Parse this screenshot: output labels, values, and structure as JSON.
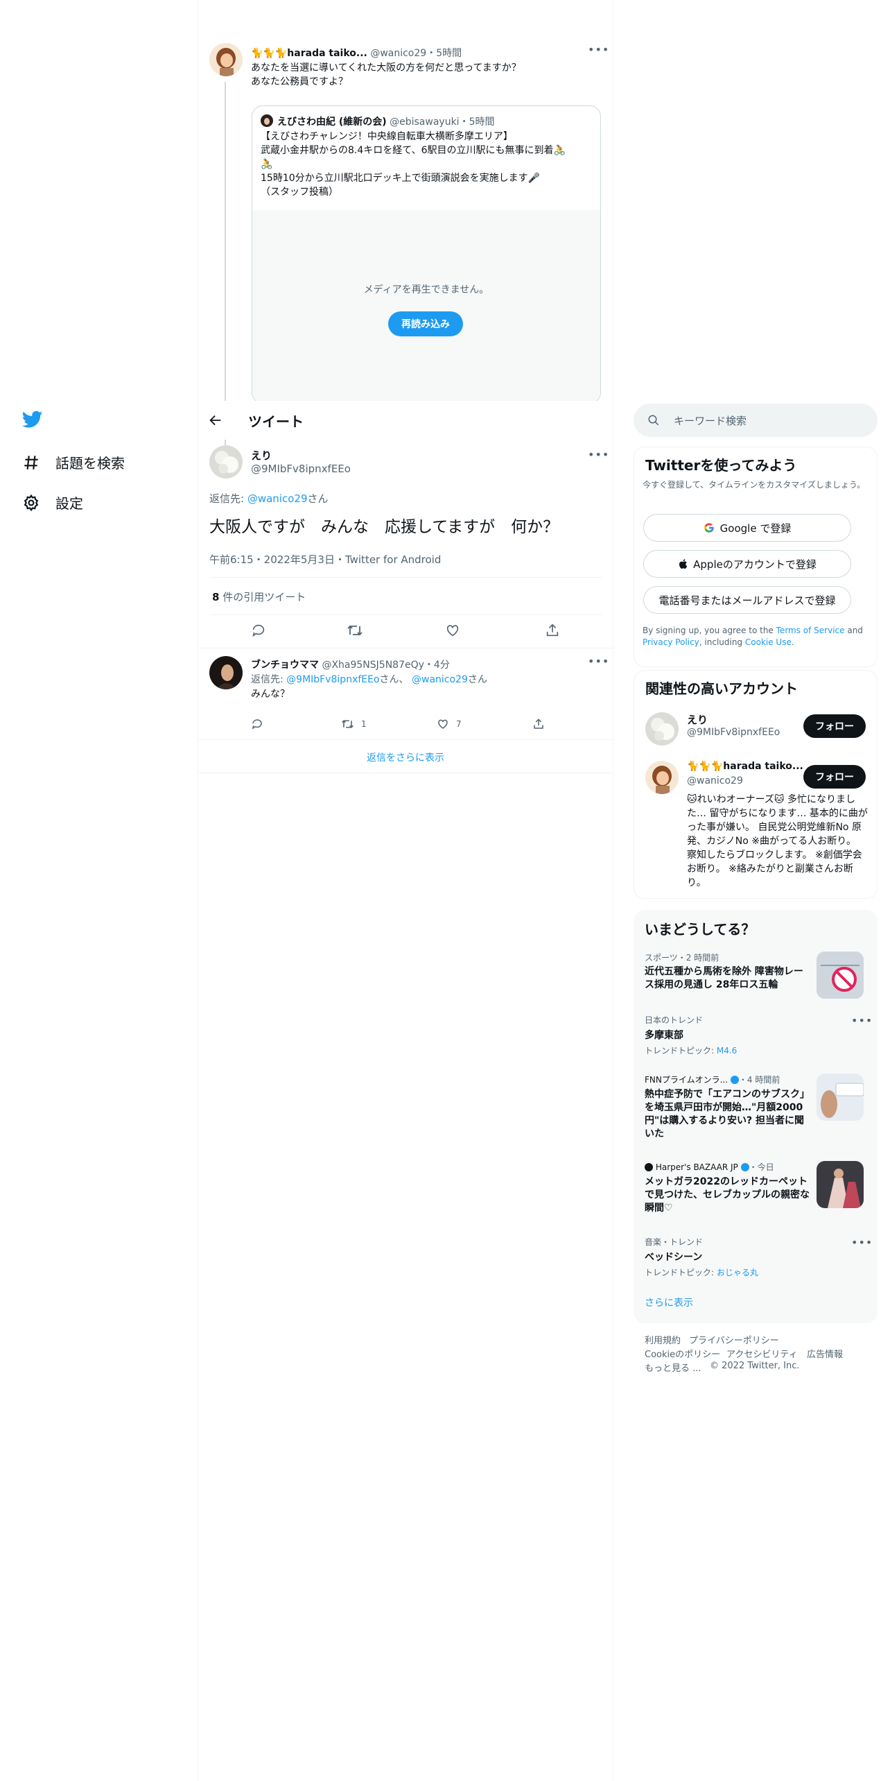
{
  "nav": {
    "items": [
      {
        "label": "話題を検索",
        "icon": "hashtag-icon"
      },
      {
        "label": "設定",
        "icon": "gear-icon"
      }
    ]
  },
  "parent_tweet": {
    "emoji": "🐈🐈🐈",
    "name": "harada taiko...",
    "handle": "@wanico29",
    "time": "5時間",
    "line1": "あなたを当選に導いてくれた大阪の方を何だと思ってますか？",
    "line2": "あなた公務員ですよ？"
  },
  "quoted_tweet": {
    "name": "えびさわ由紀 (維新の会)",
    "handle": "@ebisawayuki",
    "time": "5時間",
    "line1": "【えびさわチャレンジ！中央線自転車大横断多摩エリア】",
    "line2": "武蔵小金井駅からの8.4キロを経て、6駅目の立川駅にも無事に到着🚴",
    "line2b": "🚴",
    "line3": "15時10分から立川駅北口デッキ上で街頭演説会を実施します🎤",
    "line4": "（スタッフ投稿）",
    "media_message": "メディアを再生できません。",
    "reload_label": "再読み込み"
  },
  "header": {
    "title": "ツイート"
  },
  "main_tweet": {
    "name": "えり",
    "handle": "@9MIbFv8ipnxfEEo",
    "reply_prefix": "返信先:",
    "reply_to": "@wanico29",
    "reply_suffix": "さん",
    "text": "大阪人ですが　みんな　応援してますが　何か？",
    "timestamp": "午前6:15・2022年5月3日・Twitter for Android",
    "quote_count": "8",
    "quote_label": "件の引用ツイート"
  },
  "reply_tweet": {
    "name": "ブンチョウママ",
    "handle": "@Xha95NSJ5N87eQy",
    "time": "4分",
    "reply_prefix": "返信先:",
    "reply_to1": "@9MIbFv8ipnxfEEo",
    "reply_mid": "さん、",
    "reply_to2": "@wanico29",
    "reply_suffix": "さん",
    "text": "みんな？",
    "retweets": "1",
    "likes": "7"
  },
  "show_more_replies": "返信をさらに表示",
  "search": {
    "placeholder": "キーワード検索"
  },
  "signup": {
    "title": "Twitterを使ってみよう",
    "subtitle": "今すぐ登録して、タイムラインをカスタマイズしましょう。",
    "google_label": "Google で登録",
    "apple_label": "Appleのアカウントで登録",
    "phone_label": "電話番号またはメールアドレスで登録",
    "terms_pre": "By signing up, you agree to the ",
    "terms_link": "Terms of Service",
    "terms_and": " and ",
    "privacy_link": "Privacy Policy",
    "terms_including": ", including ",
    "cookie_link": "Cookie Use",
    "terms_end": "."
  },
  "related": {
    "title": "関連性の高いアカウント",
    "follow_label": "フォロー",
    "accounts": [
      {
        "name": "えり",
        "handle": "@9MIbFv8ipnxfEEo"
      },
      {
        "emoji": "🐈🐈🐈",
        "name": "harada taiko...",
        "handle": "@wanico29",
        "bio": "🐱れいわオーナーズ🐱 多忙になりました… 留守がちになります… 基本的に曲がった事が嫌い。 自民党公明党維新No 原発、カジノNo ※曲がってる人お断り。 察知したらブロックします。 ※創価学会お断り。 ※絡みたがりと副業さんお断り。"
      }
    ]
  },
  "trends": {
    "title": "いまどうしてる？",
    "items": [
      {
        "context": "スポーツ・2 時間前",
        "headline": "近代五種から馬術を除外 障害物レース採用の見通し 28年ロス五輪"
      },
      {
        "context": "日本のトレンド",
        "headline": "多摩東部",
        "topic_prefix": "トレンドトピック: ",
        "topic": "M4.6"
      },
      {
        "source": "FNNプライムオンラ...",
        "time": "・4 時間前",
        "headline": "熱中症予防で「エアコンのサブスク」を埼玉県戸田市が開始…\"月額2000円\"は購入するより安い? 担当者に聞いた"
      },
      {
        "source": "Harper's BAZAAR JP",
        "time": "・今日",
        "headline": "メットガラ2022のレッドカーペットで見つけた、セレブカップルの親密な瞬間♡"
      },
      {
        "context": "音楽・トレンド",
        "headline": "ベッドシーン",
        "topic_prefix": "トレンドトピック: ",
        "topic": "おじゃる丸"
      }
    ],
    "show_more": "さらに表示"
  },
  "footer": {
    "terms": "利用規約",
    "privacy": "プライバシーポリシー",
    "cookie": "Cookieのポリシー",
    "accessibility": "アクセシビリティ",
    "ads": "広告情報",
    "more": "もっと見る ...",
    "copyright": "© 2022 Twitter, Inc."
  },
  "colors": {
    "accent": "#1d9bf0",
    "text": "#0f1419",
    "muted": "#536471",
    "border": "#eff3f4"
  }
}
